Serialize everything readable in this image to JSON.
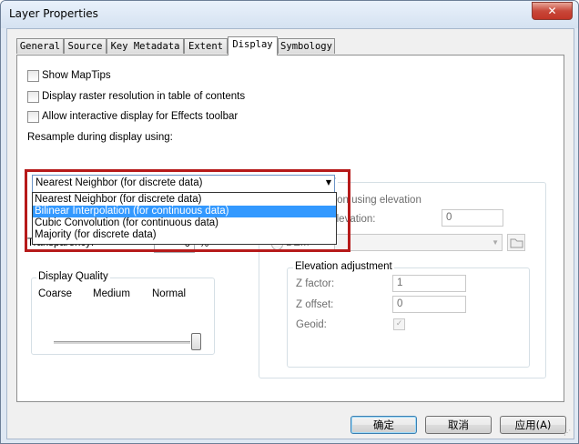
{
  "window": {
    "title": "Layer Properties",
    "close_label": "✕"
  },
  "tabs": [
    {
      "label": "General"
    },
    {
      "label": "Source"
    },
    {
      "label": "Key Metadata"
    },
    {
      "label": "Extent"
    },
    {
      "label": "Display",
      "active": true
    },
    {
      "label": "Symbology"
    }
  ],
  "display": {
    "show_maptips": {
      "label": "Show MapTips",
      "checked": false
    },
    "display_resolution": {
      "label": "Display raster resolution in table of contents",
      "checked": false
    },
    "allow_interactive": {
      "label": "Allow interactive display for Effects toolbar",
      "checked": false
    },
    "resample_label": "Resample during display using:",
    "resample_value": "Nearest Neighbor (for discrete data)",
    "resample_options": [
      "Nearest Neighbor (for discrete data)",
      "Bilinear Interpolation (for continuous data)",
      "Cubic Convolution (for continuous data)",
      "Majority (for discrete data)"
    ],
    "resample_highlighted_index": 1,
    "hidden_row_value": "0",
    "hidden_row_unit": "%",
    "transparency_label": "Transparency:",
    "transparency_value": "0",
    "transparency_unit": "%"
  },
  "display_quality": {
    "title": "Display Quality",
    "coarse": "Coarse",
    "medium": "Medium",
    "normal": "Normal",
    "level": 1.0
  },
  "elevation": {
    "group_title_partial": "r",
    "option_partial": "ation using elevation",
    "constant_label": "Constant elevation:",
    "constant_value": "0",
    "dem_label": "DEM",
    "dem_value": "",
    "adjustment_title": "Elevation adjustment",
    "z_factor_label": "Z factor:",
    "z_factor_value": "1",
    "z_offset_label": "Z offset:",
    "z_offset_value": "0",
    "geoid_label": "Geoid:",
    "geoid_checked": true
  },
  "buttons": {
    "ok": "确定",
    "cancel": "取消",
    "apply": "应用(A)"
  },
  "colors": {
    "highlight": "#3399ff",
    "annotation_box": "#b61a1a",
    "title_bar": "#dbe6f3"
  }
}
